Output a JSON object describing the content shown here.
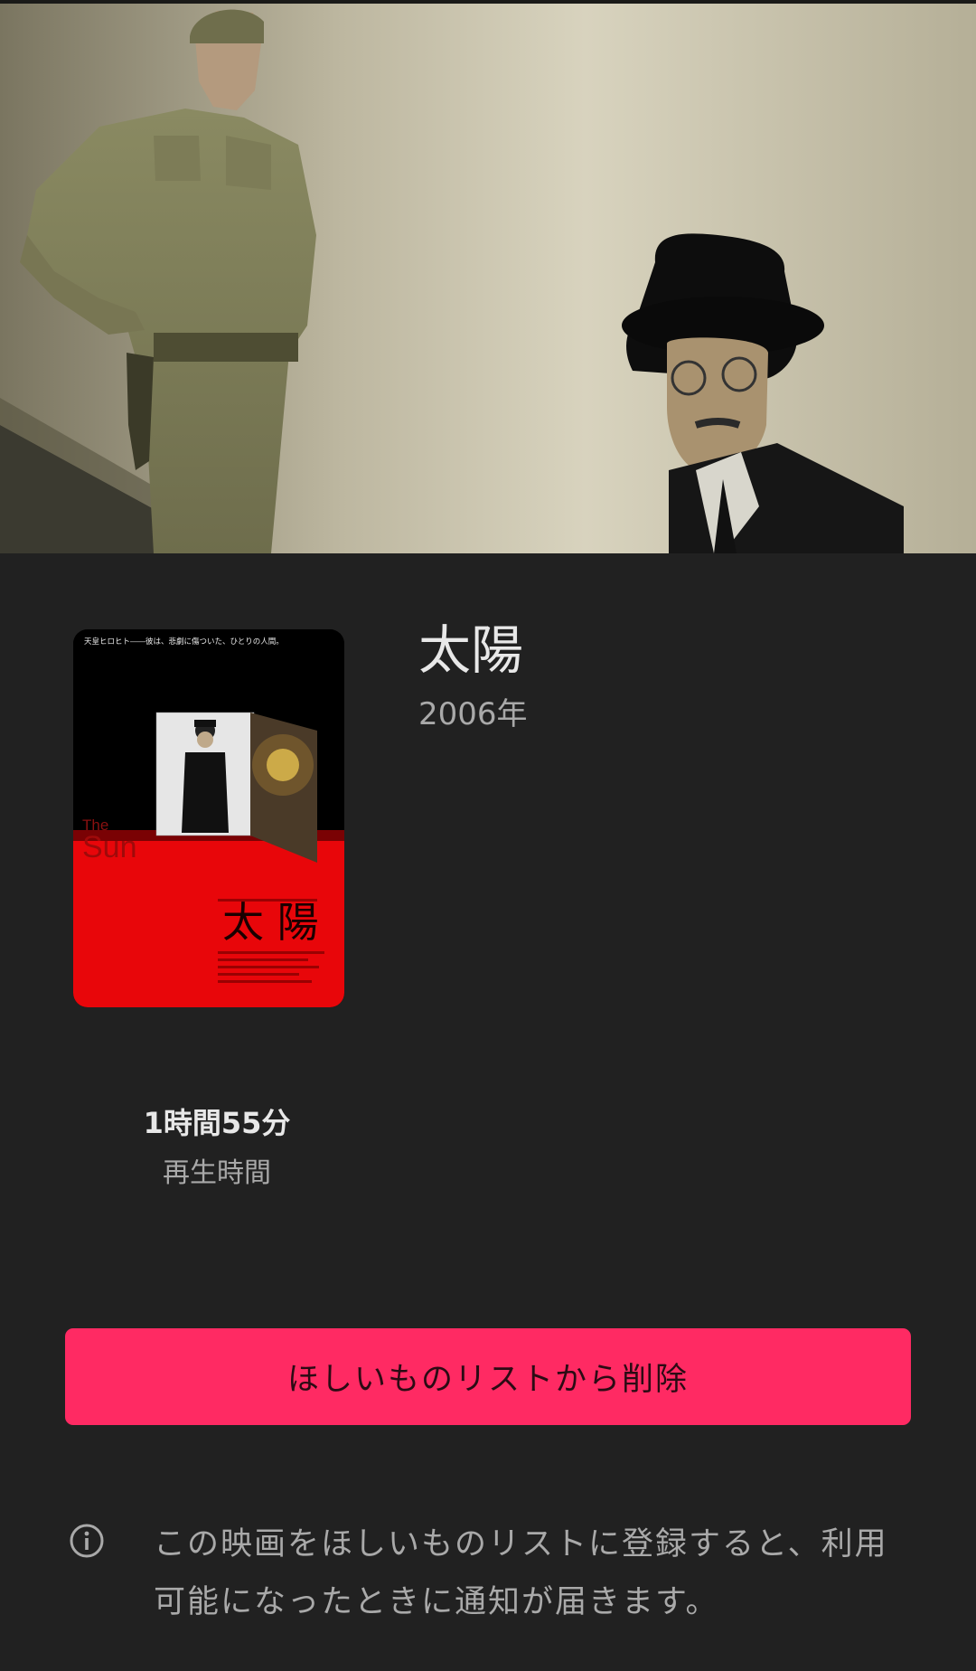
{
  "movie": {
    "title": "太陽",
    "year": "2006年",
    "poster_tagline": "天皇ヒロヒト――彼は、悲劇に傷ついた、ひとりの人間。",
    "poster_en_title_1": "The",
    "poster_en_title_2": "Sun",
    "poster_jp_title": "太 陽"
  },
  "runtime": {
    "value": "1時間55分",
    "label": "再生時間"
  },
  "wishlist": {
    "button_label": "ほしいものリストから削除",
    "button_color": "#ff2a63",
    "info_icon": "info-icon",
    "info_text": "この映画をほしいものリストに登録すると、利用可能になったときに通知が届きます。"
  },
  "theme": {
    "background": "#212121",
    "text_primary": "#e8e8e8",
    "text_secondary": "#a9a9a9"
  }
}
